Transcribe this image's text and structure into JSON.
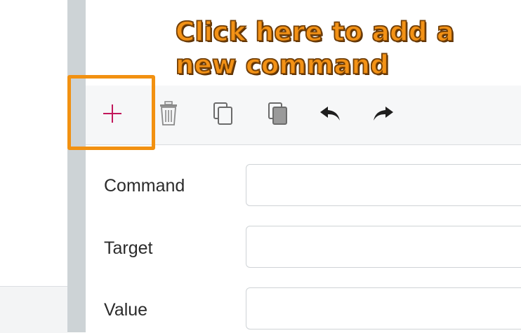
{
  "annotation": {
    "line1": "Click here to add a",
    "line2": "new command",
    "highlight_color": "#f29111"
  },
  "toolbar": {
    "add_icon": "plus-icon",
    "delete_icon": "trash-icon",
    "copy_icon": "copy-icon",
    "paste_icon": "paste-icon",
    "undo_icon": "undo-arrow-icon",
    "redo_icon": "redo-arrow-icon",
    "add_color": "#c2185b"
  },
  "form": {
    "command_label": "Command",
    "command_value": "",
    "target_label": "Target",
    "target_value": "",
    "value_label": "Value",
    "value_value": ""
  }
}
